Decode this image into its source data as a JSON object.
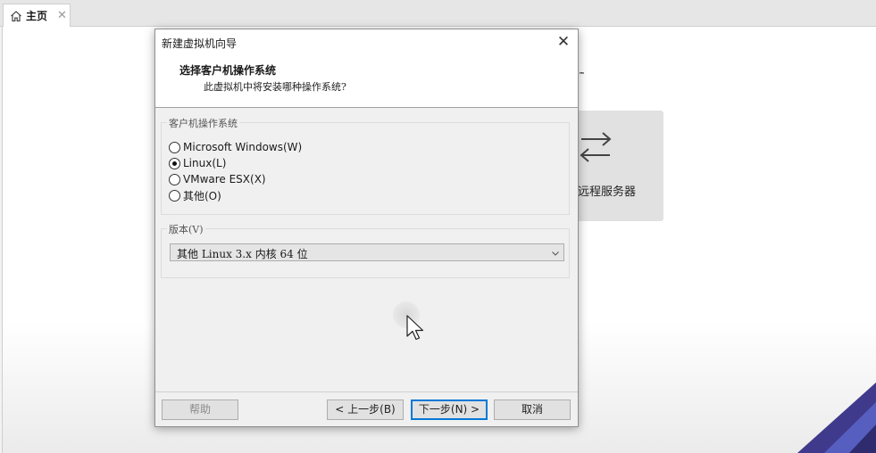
{
  "tabs": [
    {
      "label": "主页",
      "icon": "home-icon",
      "close_icon": "close-icon"
    }
  ],
  "home": {
    "trademark": "™",
    "remote_server_label": "远程服务器"
  },
  "dialog": {
    "title": "新建虚拟机向导",
    "heading": "选择客户机操作系统",
    "subheading": "此虚拟机中将安装哪种操作系统?",
    "os_group": {
      "legend": "客户机操作系统",
      "options": [
        {
          "label": "Microsoft Windows(W)",
          "selected": false
        },
        {
          "label": "Linux(L)",
          "selected": true
        },
        {
          "label": "VMware ESX(X)",
          "selected": false
        },
        {
          "label": "其他(O)",
          "selected": false
        }
      ]
    },
    "version_group": {
      "legend": "版本(V)",
      "selected": "其他 Linux 3.x 内核 64 位"
    },
    "buttons": {
      "help": "帮助",
      "back": "< 上一步(B)",
      "next": "下一步(N) >",
      "cancel": "取消"
    }
  },
  "colors": {
    "accent": "#0078d7",
    "dialog_bg": "#f0f0f0",
    "deco_primary": "#3f3a8c"
  }
}
